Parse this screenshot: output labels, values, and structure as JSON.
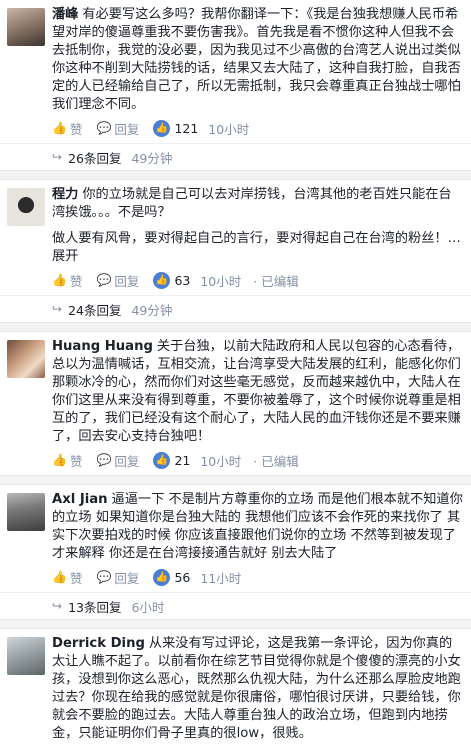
{
  "comments": [
    {
      "author": "潘峰",
      "text": "有必要写这么多吗？我帮你翻译一下：《我是台独我想赚人民币希望对岸的傻逼尊重我不要伤害我》。首先我是看不惯你这种人但我不会去抵制你，我觉的没必要，因为我见过不少高傲的台湾艺人说出过类似你这种不削到大陆捞钱的话，结果又去大陆了，这种自我打脸，自我否定的人已经输给自己了，所以无需抵制，我只会尊重真正台独战士哪怕我们理念不同。",
      "actions": {
        "like": "赞",
        "reply": "回复"
      },
      "likes": "121",
      "time": "10小时",
      "edited": "",
      "replies": {
        "count": "26条回复",
        "time": "49分钟"
      }
    },
    {
      "author": "程力",
      "text": "你的立场就是自己可以去对岸捞钱，台湾其他的老百姓只能在台湾挨饿。。。不是吗？",
      "text2": "做人要有风骨，要对得起自己的言行，要对得起自己在台湾的粉丝！…",
      "more": "展开",
      "actions": {
        "like": "赞",
        "reply": "回复"
      },
      "likes": "63",
      "time": "10小时",
      "edited": "已编辑",
      "replies": {
        "count": "24条回复",
        "time": "49分钟"
      }
    },
    {
      "author": "Huang Huang",
      "text": "关于台独，以前大陆政府和人民以包容的心态看待，总以为温情喊话，互相交流，让台湾享受大陆发展的红利，能感化你们那颗冰冷的心，然而你们对这些毫无感觉，反而越来越仇中，大陆人在你们这里从来没有得到尊重，不要你被羞辱了，这个时候你说尊重是相互的了，我们已经没有这个耐心了，大陆人民的血汗钱你还是不要来赚了，回去安心支持台独吧！",
      "actions": {
        "like": "赞",
        "reply": "回复"
      },
      "likes": "21",
      "time": "10小时",
      "edited": "已编辑",
      "replies": null
    },
    {
      "author": "Axl Jian",
      "text": "逼逼一下 不是制片方尊重你的立场 而是他们根本就不知道你的立场 如果知道你是台独大陆的 我想他们应该不会作死的来找你了 其实下次要拍戏的时候 你应该直接跟他们说你的立场 不然等到被发现了才来解释 你还是在台湾接接通告就好 别去大陆了",
      "actions": {
        "like": "赞",
        "reply": "回复"
      },
      "likes": "56",
      "time": "11小时",
      "edited": "",
      "replies": {
        "count": "13条回复",
        "time": "6小时"
      }
    },
    {
      "author": "Derrick Ding",
      "text": "从来没有写过评论，这是我第一条评论，因为你真的太让人瞧不起了。以前看你在综艺节目觉得你就是个傻傻的漂亮的小女孩，没想到你这么恶心，既然那么仇视大陆，为什么还那么厚脸皮地跑过去？你现在给我的感觉就是你很庸俗，哪怕很讨厌讲，只要给钱，你就会不要脸的跑过去。大陆人尊重台独人的政治立场，但跑到内地捞金，只能证明你们骨子里真的很low，很贱。",
      "actions": null,
      "likes": "",
      "time": "",
      "edited": "",
      "replies": null
    }
  ],
  "icons": {
    "like": "thumbs-up-icon",
    "reply": "reply-icon",
    "accent": "#4a7fd6"
  }
}
